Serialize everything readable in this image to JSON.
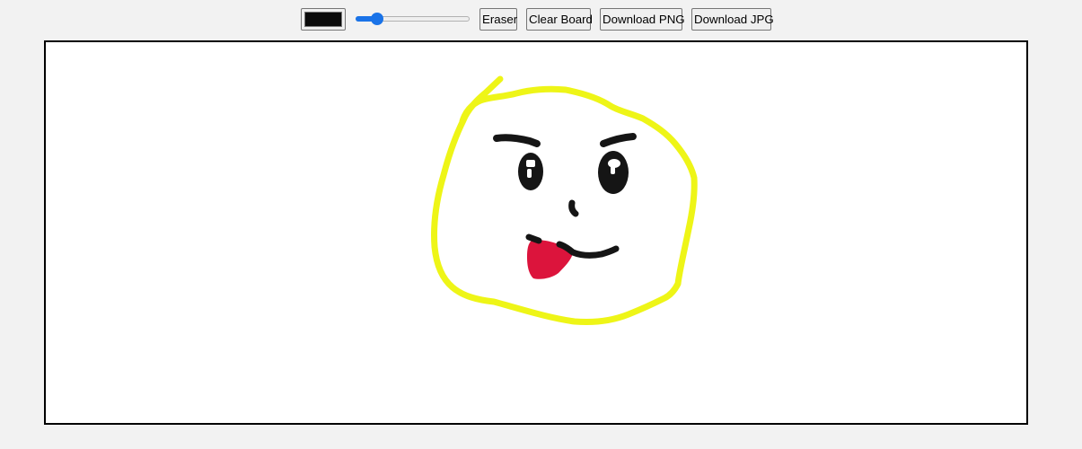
{
  "toolbar": {
    "color_value": "#0a0a0a",
    "brush_size_fraction": 0.19,
    "eraser_label": "Eraser",
    "clear_label": "Clear Board",
    "download_png_label": "Download PNG",
    "download_jpg_label": "Download JPG"
  },
  "drawing": {
    "stroke_colors": {
      "face_outline": "#eef517",
      "features": "#151515",
      "tongue": "#dc143c"
    }
  }
}
